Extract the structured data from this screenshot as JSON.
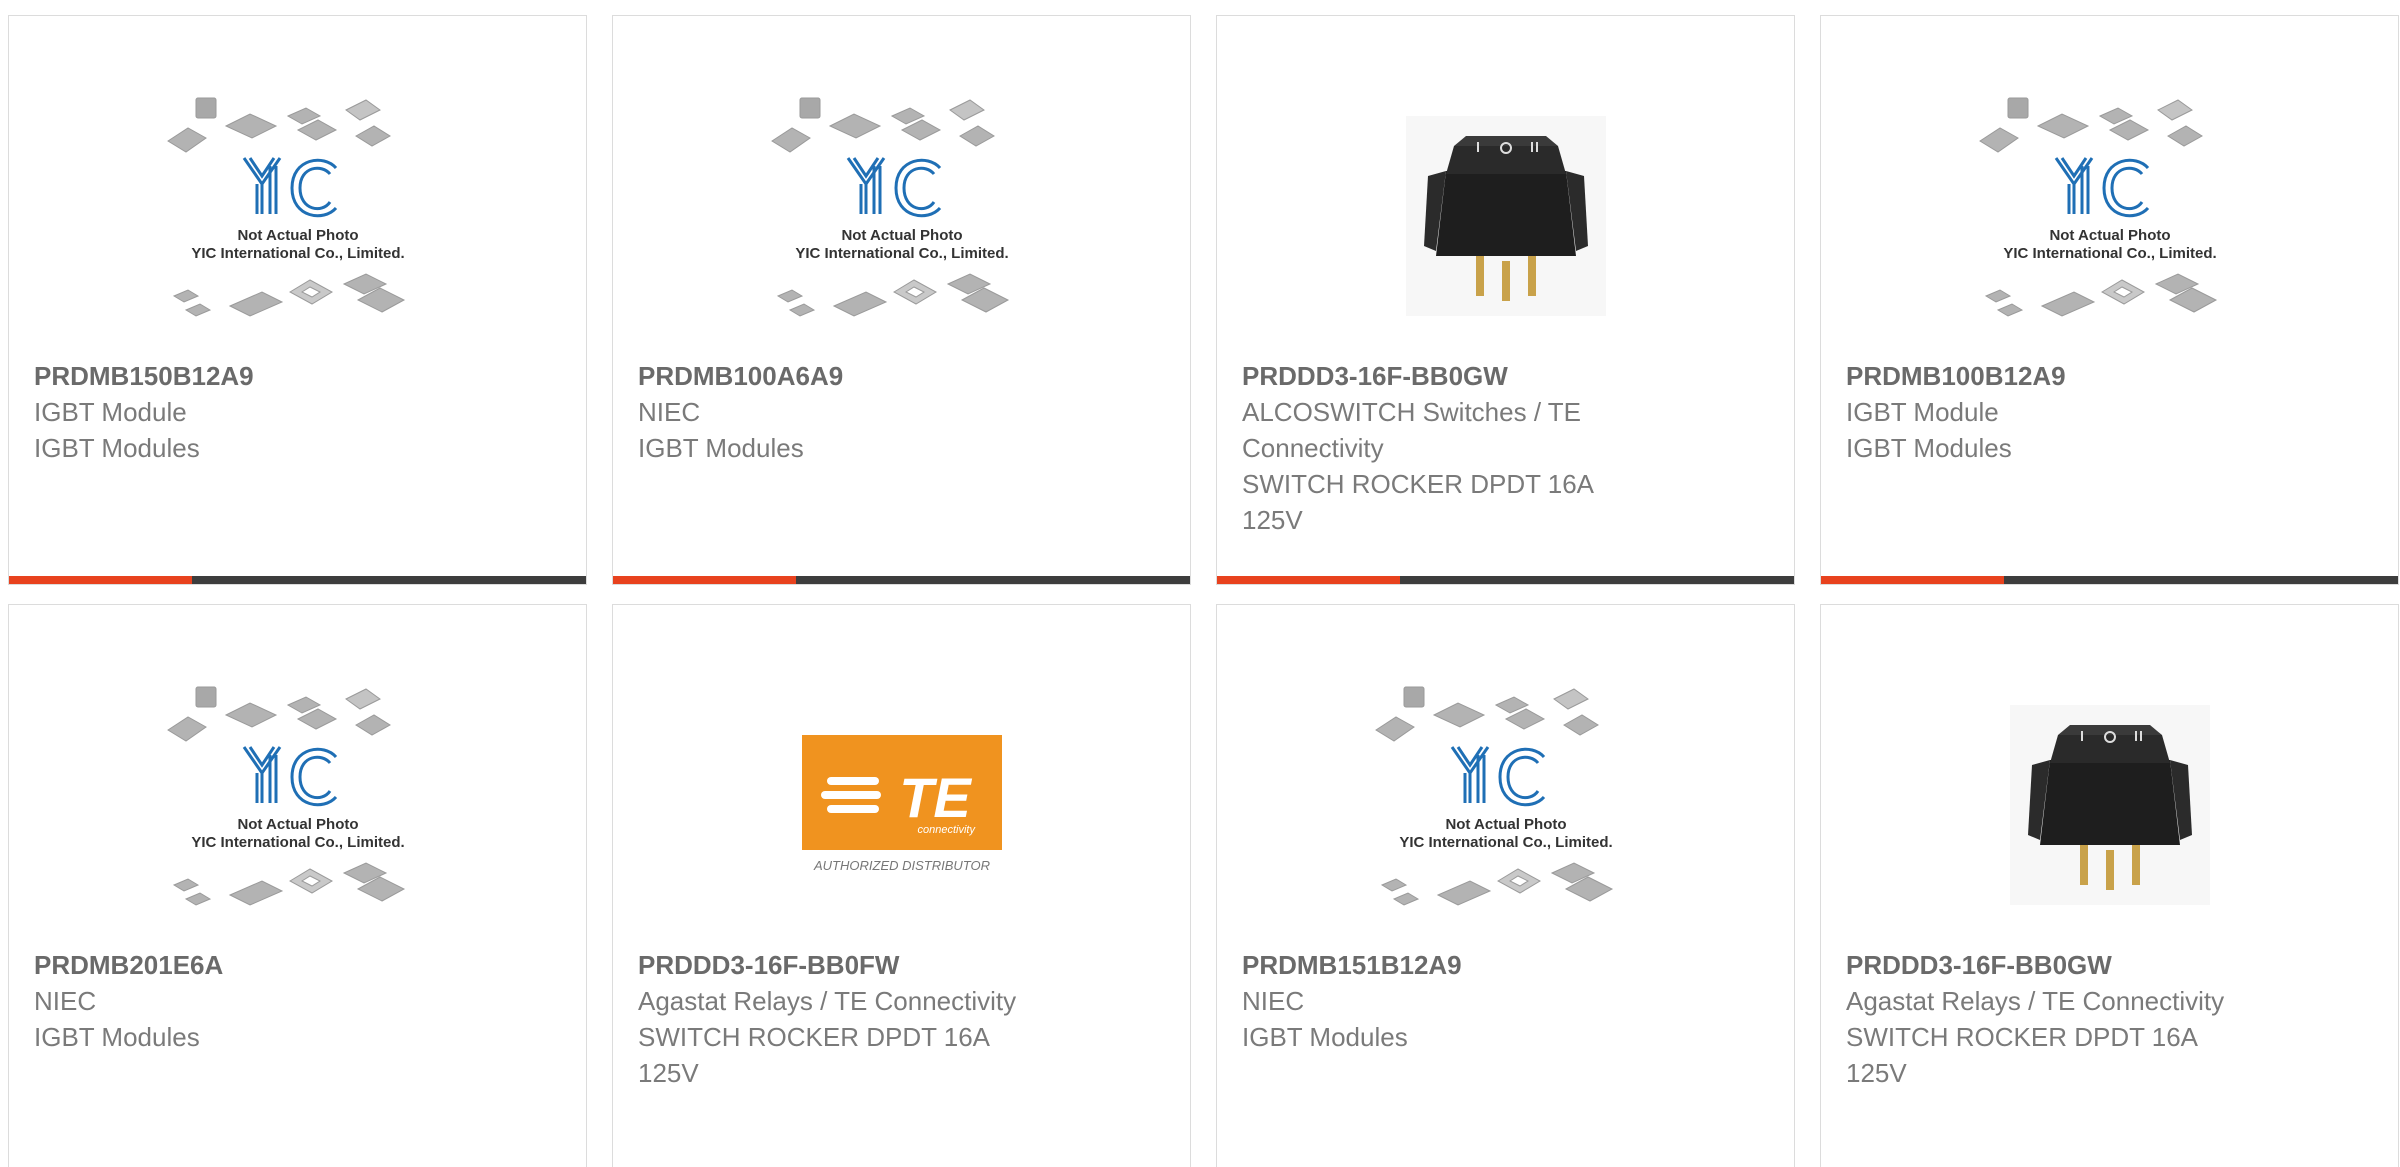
{
  "colors": {
    "accent": "#e8421e",
    "bar_dark": "#3d3d3d",
    "yic_blue": "#1f6fb5",
    "te_orange": "#f0931f"
  },
  "placeholder": {
    "line1": "Not Actual Photo",
    "line2": "YIC International Co., Limited.",
    "logo_text": "YIC"
  },
  "te_logo": {
    "brand": "TE",
    "sub": "connectivity",
    "caption": "AUTHORIZED DISTRIBUTOR"
  },
  "products": [
    {
      "part": "PRDMB150B12A9",
      "line1": "IGBT Module",
      "line2": "IGBT Modules",
      "line3": "",
      "image": "yic-placeholder"
    },
    {
      "part": "PRDMB100A6A9",
      "line1": "NIEC",
      "line2": "IGBT Modules",
      "line3": "",
      "image": "yic-placeholder"
    },
    {
      "part": "PRDDD3-16F-BB0GW",
      "line1": "ALCOSWITCH Switches / TE",
      "line2": "Connectivity",
      "line3": "SWITCH ROCKER DPDT 16A",
      "line4": "125V",
      "image": "rocker-switch-photo"
    },
    {
      "part": "PRDMB100B12A9",
      "line1": "IGBT Module",
      "line2": "IGBT Modules",
      "line3": "",
      "image": "yic-placeholder"
    },
    {
      "part": "PRDMB201E6A",
      "line1": "NIEC",
      "line2": "IGBT Modules",
      "line3": "",
      "image": "yic-placeholder"
    },
    {
      "part": "PRDDD3-16F-BB0FW",
      "line1": "Agastat Relays / TE Connectivity",
      "line2": "SWITCH ROCKER DPDT 16A",
      "line3": "125V",
      "image": "te-logo"
    },
    {
      "part": "PRDMB151B12A9",
      "line1": "NIEC",
      "line2": "IGBT Modules",
      "line3": "",
      "image": "yic-placeholder"
    },
    {
      "part": "PRDDD3-16F-BB0GW",
      "line1": "Agastat Relays / TE Connectivity",
      "line2": "SWITCH ROCKER DPDT 16A",
      "line3": "125V",
      "image": "rocker-switch-photo"
    }
  ]
}
